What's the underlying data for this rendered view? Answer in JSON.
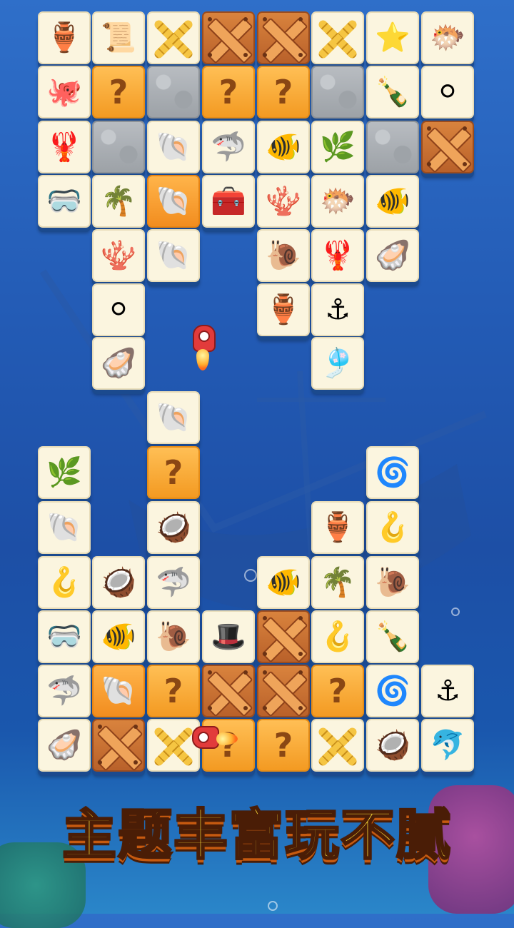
{
  "game": {
    "banner_text": "主题丰富玩不腻",
    "board": {
      "tiles": [
        {
          "name": "tile-pot",
          "kind": "plain",
          "glyph": "🏺"
        },
        {
          "name": "tile-map",
          "kind": "plain",
          "glyph": "📜"
        },
        {
          "name": "tile-chain-lock",
          "kind": "chain",
          "glyph": ""
        },
        {
          "name": "tile-crate",
          "kind": "crate",
          "glyph": ""
        },
        {
          "name": "tile-crate",
          "kind": "crate",
          "glyph": ""
        },
        {
          "name": "tile-chain-lock",
          "kind": "chain",
          "glyph": ""
        },
        {
          "name": "tile-starfish",
          "kind": "plain",
          "glyph": "⭐"
        },
        {
          "name": "tile-pufferfish",
          "kind": "plain",
          "glyph": "🐡"
        },
        {
          "name": "tile-octopus",
          "kind": "plain",
          "glyph": "🐙"
        },
        {
          "name": "tile-mystery",
          "kind": "q",
          "glyph": "?"
        },
        {
          "name": "tile-stone",
          "kind": "stone",
          "glyph": ""
        },
        {
          "name": "tile-mystery",
          "kind": "q",
          "glyph": "?"
        },
        {
          "name": "tile-mystery",
          "kind": "q",
          "glyph": "?"
        },
        {
          "name": "tile-stone",
          "kind": "stone",
          "glyph": ""
        },
        {
          "name": "tile-bottle",
          "kind": "plain",
          "glyph": "🍾"
        },
        {
          "name": "tile-pearl",
          "kind": "plain",
          "glyph": "⚪"
        },
        {
          "name": "tile-lobster-claw",
          "kind": "plain",
          "glyph": "🦞"
        },
        {
          "name": "tile-stone",
          "kind": "stone",
          "glyph": ""
        },
        {
          "name": "tile-conch",
          "kind": "plain",
          "glyph": "🐚"
        },
        {
          "name": "tile-stingray",
          "kind": "plain",
          "glyph": "🦈"
        },
        {
          "name": "tile-clownfish",
          "kind": "plain",
          "glyph": "🐠"
        },
        {
          "name": "tile-seaweed",
          "kind": "plain",
          "glyph": "🌿"
        },
        {
          "name": "tile-stone",
          "kind": "stone",
          "glyph": ""
        },
        {
          "name": "tile-crate",
          "kind": "crate",
          "glyph": ""
        },
        {
          "name": "tile-goggles",
          "kind": "plain",
          "glyph": "🥽"
        },
        {
          "name": "tile-palm",
          "kind": "plain",
          "glyph": "🌴"
        },
        {
          "name": "tile-scallop",
          "kind": "orange",
          "glyph": "🐚"
        },
        {
          "name": "tile-treasure-chest",
          "kind": "plain",
          "glyph": "🧰"
        },
        {
          "name": "tile-coral",
          "kind": "plain",
          "glyph": "🪸"
        },
        {
          "name": "tile-pufferfish",
          "kind": "plain",
          "glyph": "🐡"
        },
        {
          "name": "tile-clownfish",
          "kind": "plain",
          "glyph": "🐠"
        },
        {
          "name": "tile-coral",
          "kind": "plain",
          "glyph": "🪸"
        },
        {
          "name": "tile-conch",
          "kind": "plain",
          "glyph": "🐚"
        },
        {
          "name": "tile-spiral-shell",
          "kind": "plain",
          "glyph": "🐌"
        },
        {
          "name": "tile-lobster-claw",
          "kind": "plain",
          "glyph": "🦞"
        },
        {
          "name": "tile-oyster",
          "kind": "plain",
          "glyph": "🦪"
        },
        {
          "name": "tile-pearl",
          "kind": "plain",
          "glyph": "⚪"
        },
        {
          "name": "tile-pot",
          "kind": "plain",
          "glyph": "🏺"
        },
        {
          "name": "tile-anchor",
          "kind": "plain",
          "glyph": "⚓"
        },
        {
          "name": "tile-clam-pearl",
          "kind": "plain",
          "glyph": "🦪"
        },
        {
          "name": "tile-jellyfish",
          "kind": "plain",
          "glyph": "🎐"
        },
        {
          "name": "tile-conch",
          "kind": "plain",
          "glyph": "🐚"
        },
        {
          "name": "tile-seaweed",
          "kind": "plain",
          "glyph": "🌿"
        },
        {
          "name": "tile-mystery",
          "kind": "q",
          "glyph": "?"
        },
        {
          "name": "tile-nautilus",
          "kind": "plain",
          "glyph": "🌀"
        },
        {
          "name": "tile-scallop",
          "kind": "plain",
          "glyph": "🐚"
        },
        {
          "name": "tile-coconut",
          "kind": "plain",
          "glyph": "🥥"
        },
        {
          "name": "tile-pot",
          "kind": "plain",
          "glyph": "🏺"
        },
        {
          "name": "tile-hook",
          "kind": "plain",
          "glyph": "🪝"
        },
        {
          "name": "tile-hook",
          "kind": "plain",
          "glyph": "🪝"
        },
        {
          "name": "tile-coconut",
          "kind": "plain",
          "glyph": "🥥"
        },
        {
          "name": "tile-stingray",
          "kind": "plain",
          "glyph": "🦈"
        },
        {
          "name": "tile-clownfish",
          "kind": "plain",
          "glyph": "🐠"
        },
        {
          "name": "tile-palm",
          "kind": "plain",
          "glyph": "🌴"
        },
        {
          "name": "tile-spiral-shell",
          "kind": "plain",
          "glyph": "🐌"
        },
        {
          "name": "tile-goggles",
          "kind": "plain",
          "glyph": "🥽"
        },
        {
          "name": "tile-clownfish",
          "kind": "plain",
          "glyph": "🐠"
        },
        {
          "name": "tile-spiral-shell",
          "kind": "plain",
          "glyph": "🐌"
        },
        {
          "name": "tile-pirate-hat",
          "kind": "plain",
          "glyph": "🎩"
        },
        {
          "name": "tile-crate",
          "kind": "crate",
          "glyph": ""
        },
        {
          "name": "tile-hook",
          "kind": "plain",
          "glyph": "🪝"
        },
        {
          "name": "tile-bottle",
          "kind": "plain",
          "glyph": "🍾"
        },
        {
          "name": "tile-stingray",
          "kind": "plain",
          "glyph": "🦈"
        },
        {
          "name": "tile-scallop",
          "kind": "orange",
          "glyph": "🐚"
        },
        {
          "name": "tile-mystery",
          "kind": "q",
          "glyph": "?"
        },
        {
          "name": "tile-crate",
          "kind": "crate",
          "glyph": ""
        },
        {
          "name": "tile-crate",
          "kind": "crate",
          "glyph": ""
        },
        {
          "name": "tile-mystery",
          "kind": "q",
          "glyph": "?"
        },
        {
          "name": "tile-nautilus",
          "kind": "plain",
          "glyph": "🌀"
        },
        {
          "name": "tile-anchor",
          "kind": "plain",
          "glyph": "⚓"
        },
        {
          "name": "tile-clam-pearl",
          "kind": "plain",
          "glyph": "🦪"
        },
        {
          "name": "tile-crate",
          "kind": "crate",
          "glyph": ""
        },
        {
          "name": "tile-chain-lock",
          "kind": "chain",
          "glyph": ""
        },
        {
          "name": "tile-mystery",
          "kind": "q",
          "glyph": "?"
        },
        {
          "name": "tile-mystery",
          "kind": "q",
          "glyph": "?"
        },
        {
          "name": "tile-chain-lock",
          "kind": "chain",
          "glyph": ""
        },
        {
          "name": "tile-coconut",
          "kind": "plain",
          "glyph": "🥥"
        },
        {
          "name": "tile-dolphin",
          "kind": "plain",
          "glyph": "🐬"
        }
      ]
    },
    "rockets": [
      {
        "name": "rocket-powerup"
      },
      {
        "name": "rocket-powerup"
      }
    ]
  }
}
